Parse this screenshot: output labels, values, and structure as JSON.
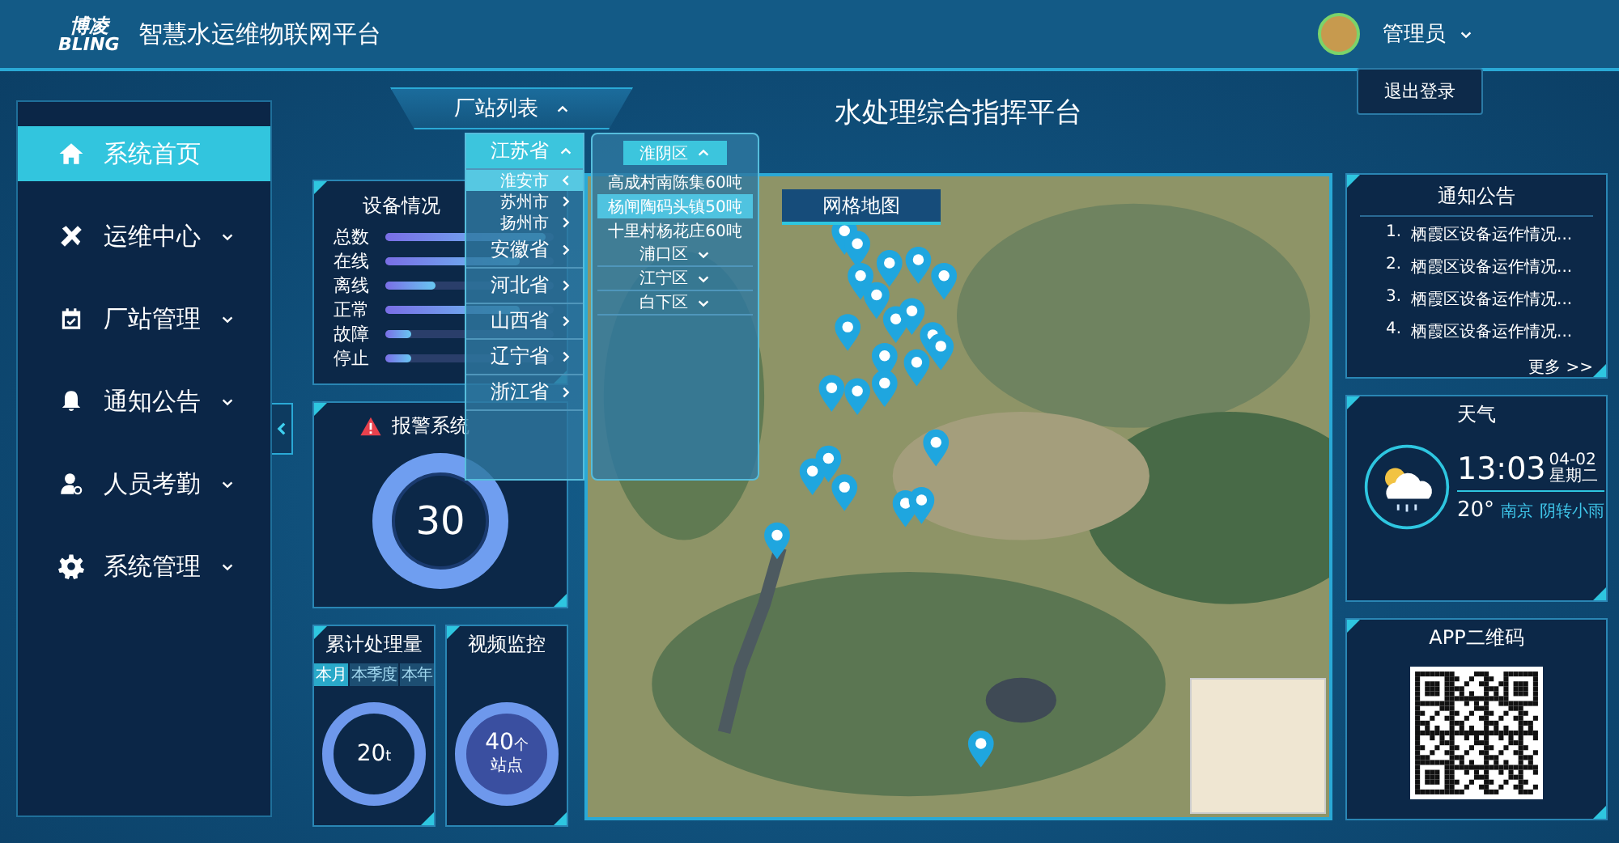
{
  "header": {
    "logo_text": "博凌",
    "logo_subtext": "BLING",
    "title": "智慧水运维物联网平台",
    "user": "管理员",
    "user_menu": [
      "退出登录"
    ]
  },
  "page_title": "水处理综合指挥平台",
  "sidebar": {
    "items": [
      {
        "label": "系统首页",
        "selected": true,
        "expandable": false
      },
      {
        "label": "运维中心",
        "selected": false,
        "expandable": true
      },
      {
        "label": "厂站管理",
        "selected": false,
        "expandable": true
      },
      {
        "label": "通知公告",
        "selected": false,
        "expandable": true
      },
      {
        "label": "人员考勤",
        "selected": false,
        "expandable": true
      },
      {
        "label": "系统管理",
        "selected": false,
        "expandable": true
      }
    ]
  },
  "station_list": {
    "label": "厂站列表",
    "expanded": true,
    "provinces": [
      {
        "name": "江苏省",
        "expanded": true,
        "cities": [
          {
            "name": "淮安市",
            "selected": true
          },
          {
            "name": "苏州市",
            "selected": false
          },
          {
            "name": "扬州市",
            "selected": false
          }
        ]
      },
      {
        "name": "安徽省",
        "expanded": false
      },
      {
        "name": "河北省",
        "expanded": false
      },
      {
        "name": "山西省",
        "expanded": false
      },
      {
        "name": "辽宁省",
        "expanded": false
      },
      {
        "name": "浙江省",
        "expanded": false
      }
    ],
    "districts": [
      {
        "name": "淮阴区",
        "expanded": true,
        "stations": [
          {
            "name": "高成村南陈集60吨",
            "selected": false
          },
          {
            "name": "杨闸陶码头镇50吨",
            "selected": true
          },
          {
            "name": "十里村杨花庄60吨",
            "selected": false
          }
        ]
      },
      {
        "name": "浦口区",
        "expanded": false
      },
      {
        "name": "江宁区",
        "expanded": false
      },
      {
        "name": "白下区",
        "expanded": false
      }
    ]
  },
  "device_status": {
    "title": "设备情况",
    "rows": [
      {
        "label": "总数",
        "level": 0.95
      },
      {
        "label": "在线",
        "level": 0.8
      },
      {
        "label": "离线",
        "level": 0.3
      },
      {
        "label": "正常",
        "level": 0.8
      },
      {
        "label": "故障",
        "level": 0.15
      },
      {
        "label": "停止",
        "level": 0.15
      }
    ]
  },
  "alarm": {
    "title": "报警系统",
    "count": "30"
  },
  "total_processed": {
    "title": "累计处理量",
    "tabs": [
      {
        "label": "本月",
        "selected": true
      },
      {
        "label": "本季度",
        "selected": false
      },
      {
        "label": "本年",
        "selected": false
      }
    ],
    "value": "20",
    "unit": "t"
  },
  "video": {
    "title": "视频监控",
    "value": "40",
    "unit": "个",
    "caption": "站点"
  },
  "map": {
    "tabs": [
      {
        "label": "网格地图",
        "selected": true
      }
    ]
  },
  "notices": {
    "title": "通知公告",
    "items": [
      {
        "number": "1.",
        "text": "栖霞区设备运作情况..."
      },
      {
        "number": "2.",
        "text": "栖霞区设备运作情况..."
      },
      {
        "number": "3.",
        "text": "栖霞区设备运作情况..."
      },
      {
        "number": "4.",
        "text": "栖霞区设备运作情况..."
      }
    ],
    "more": "更多 >>"
  },
  "weather": {
    "title": "天气",
    "time": "13:03",
    "date": "04-02",
    "weekday": "星期二",
    "temperature": "20°",
    "city": "南京",
    "condition": "阴转小雨"
  },
  "qr": {
    "title": "APP二维码"
  }
}
